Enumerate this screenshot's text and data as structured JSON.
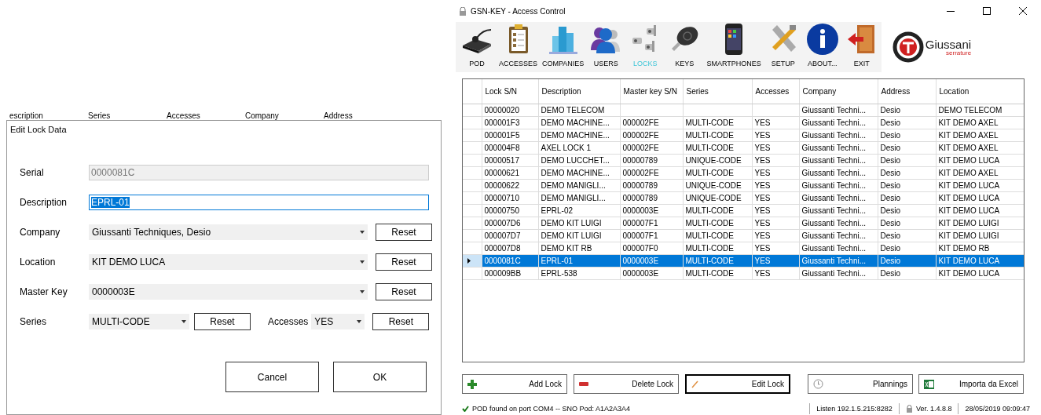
{
  "background_table": {
    "columns": [
      "escription",
      "Series",
      "Accesses",
      "Company",
      "Address"
    ]
  },
  "dialog": {
    "title": "Edit Lock Data",
    "fields": [
      {
        "kind": "text",
        "label": "Serial",
        "value": "0000081C",
        "disabled": true,
        "focused": false
      },
      {
        "kind": "text",
        "label": "Description",
        "value": "EPRL-01",
        "disabled": false,
        "focused": true
      },
      {
        "kind": "combo",
        "label": "Company",
        "value": "Giussanti Techniques, Desio",
        "button": "Reset"
      },
      {
        "kind": "combo",
        "label": "Location",
        "value": "KIT DEMO LUCA",
        "button": "Reset"
      },
      {
        "kind": "combo",
        "label": "Master Key",
        "value": "0000003E",
        "button": "Reset"
      },
      {
        "kind": "pair",
        "label": "Series",
        "value": "MULTI-CODE",
        "button": "Reset",
        "label2": "Accesses",
        "value2": "YES",
        "button2": "Reset"
      }
    ],
    "buttons": [
      "Cancel",
      "OK"
    ]
  },
  "window": {
    "title": "GSN-KEY - Access Control",
    "toolbar": [
      {
        "label": "POD",
        "selected": false
      },
      {
        "label": "ACCESSES",
        "selected": false
      },
      {
        "label": "COMPANIES",
        "selected": false
      },
      {
        "label": "USERS",
        "selected": false
      },
      {
        "label": "LOCKS",
        "selected": true
      },
      {
        "label": "KEYS",
        "selected": false
      },
      {
        "label": "SMARTPHONES",
        "selected": false
      },
      {
        "label": "SETUP",
        "selected": false
      },
      {
        "label": "ABOUT...",
        "selected": false
      },
      {
        "label": "EXIT",
        "selected": false
      }
    ],
    "logo": {
      "name": "Giussani",
      "tagline": "serrature"
    },
    "table": {
      "columns": [
        "Lock S/N",
        "Description",
        "Master key S/N",
        "Series",
        "Accesses",
        "Company",
        "Address",
        "Location"
      ],
      "rows": [
        {
          "cells": [
            "00000020",
            "DEMO TELECOM",
            "",
            "",
            "",
            "Giussanti Techni...",
            "Desio",
            "DEMO TELECOM"
          ],
          "selected": false
        },
        {
          "cells": [
            "000001F3",
            "DEMO MACHINE...",
            "000002FE",
            "MULTI-CODE",
            "YES",
            "Giussanti Techni...",
            "Desio",
            "KIT DEMO AXEL"
          ],
          "selected": false
        },
        {
          "cells": [
            "000001F5",
            "DEMO MACHINE...",
            "000002FE",
            "MULTI-CODE",
            "YES",
            "Giussanti Techni...",
            "Desio",
            "KIT DEMO AXEL"
          ],
          "selected": false
        },
        {
          "cells": [
            "000004F8",
            "AXEL LOCK 1",
            "000002FE",
            "MULTI-CODE",
            "YES",
            "Giussanti Techni...",
            "Desio",
            "KIT DEMO AXEL"
          ],
          "selected": false
        },
        {
          "cells": [
            "00000517",
            "DEMO LUCCHET...",
            "00000789",
            "UNIQUE-CODE",
            "YES",
            "Giussanti Techni...",
            "Desio",
            "KIT DEMO LUCA"
          ],
          "selected": false
        },
        {
          "cells": [
            "00000621",
            "DEMO MACHINE...",
            "000002FE",
            "MULTI-CODE",
            "YES",
            "Giussanti Techni...",
            "Desio",
            "KIT DEMO AXEL"
          ],
          "selected": false
        },
        {
          "cells": [
            "00000622",
            "DEMO MANIGLI...",
            "00000789",
            "UNIQUE-CODE",
            "YES",
            "Giussanti Techni...",
            "Desio",
            "KIT DEMO LUCA"
          ],
          "selected": false
        },
        {
          "cells": [
            "00000710",
            "DEMO MANIGLI...",
            "00000789",
            "UNIQUE-CODE",
            "YES",
            "Giussanti Techni...",
            "Desio",
            "KIT DEMO LUCA"
          ],
          "selected": false
        },
        {
          "cells": [
            "00000750",
            "EPRL-02",
            "0000003E",
            "MULTI-CODE",
            "YES",
            "Giussanti Techni...",
            "Desio",
            "KIT DEMO LUCA"
          ],
          "selected": false
        },
        {
          "cells": [
            "000007D6",
            "DEMO KIT LUIGI",
            "000007F1",
            "MULTI-CODE",
            "YES",
            "Giussanti Techni...",
            "Desio",
            "KIT DEMO LUIGI"
          ],
          "selected": false
        },
        {
          "cells": [
            "000007D7",
            "DEMO KIT LUIGI",
            "000007F1",
            "MULTI-CODE",
            "YES",
            "Giussanti Techni...",
            "Desio",
            "KIT DEMO LUIGI"
          ],
          "selected": false
        },
        {
          "cells": [
            "000007D8",
            "DEMO KIT RB",
            "000007F0",
            "MULTI-CODE",
            "YES",
            "Giussanti Techni...",
            "Desio",
            "KIT DEMO RB"
          ],
          "selected": false
        },
        {
          "cells": [
            "0000081C",
            "EPRL-01",
            "0000003E",
            "MULTI-CODE",
            "YES",
            "Giussanti Techni...",
            "Desio",
            "KIT DEMO LUCA"
          ],
          "selected": true
        },
        {
          "cells": [
            "000009BB",
            "EPRL-538",
            "0000003E",
            "MULTI-CODE",
            "YES",
            "Giussanti Techni...",
            "Desio",
            "KIT DEMO LUCA"
          ],
          "selected": false
        }
      ]
    },
    "actions": [
      {
        "label": "Add Lock",
        "focused": false
      },
      {
        "label": "Delete Lock",
        "focused": false
      },
      {
        "label": "Edit Lock",
        "focused": true
      },
      {
        "label": "Plannings",
        "focused": false
      },
      {
        "label": "Importa da Excel",
        "focused": false
      }
    ],
    "status_bar": {
      "message": "POD found on port COM4 -- SNO Pod: A1A2A3A4",
      "listen": "Listen 192.1.5.215:8282",
      "version": "Ver. 1.4.8.8",
      "datetime": "28/05/2019 09:09:47"
    }
  }
}
